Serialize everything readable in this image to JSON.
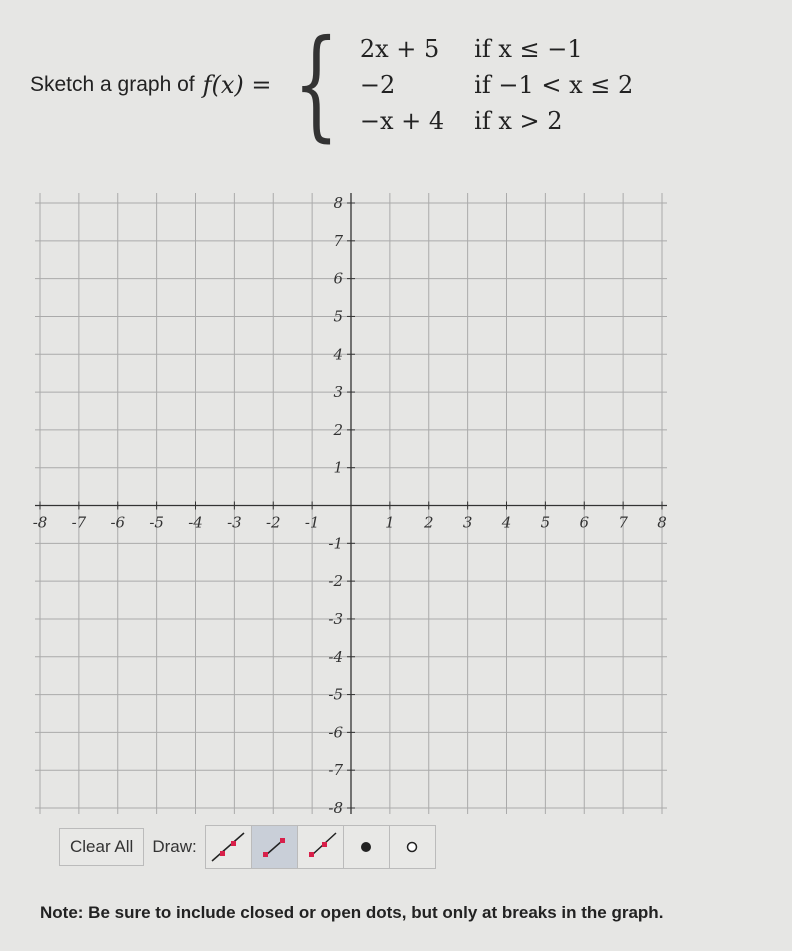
{
  "prompt": {
    "text": "Sketch a graph of",
    "lhs": "f(x) =",
    "cases": [
      {
        "expr": "2x + 5",
        "cond": "if  x ≤ −1"
      },
      {
        "expr": "−2",
        "cond": "if  −1 < x ≤ 2"
      },
      {
        "expr": "−x + 4",
        "cond": "if  x > 2"
      }
    ]
  },
  "chart_data": {
    "type": "line",
    "xlim": [
      -8,
      8
    ],
    "ylim": [
      -8,
      8
    ],
    "grid": true,
    "x_ticks": [
      "-8",
      "-7",
      "-6",
      "-5",
      "-4",
      "-3",
      "-2",
      "-1",
      "1",
      "2",
      "3",
      "4",
      "5",
      "6",
      "7",
      "8"
    ],
    "y_ticks": [
      "8",
      "7",
      "6",
      "5",
      "4",
      "3",
      "2",
      "1",
      "-1",
      "-2",
      "-3",
      "-4",
      "-5",
      "-6",
      "-7",
      "-8"
    ],
    "series": []
  },
  "toolbar": {
    "clear_label": "Clear All",
    "draw_label": "Draw:",
    "tools": [
      "line-icon",
      "segment-icon",
      "ray-icon",
      "closed-dot-icon",
      "open-dot-icon"
    ],
    "active_tool": "segment-icon",
    "point_color": "#d8204a"
  },
  "note": "Note: Be sure to include closed or open dots, but only at breaks in the graph."
}
